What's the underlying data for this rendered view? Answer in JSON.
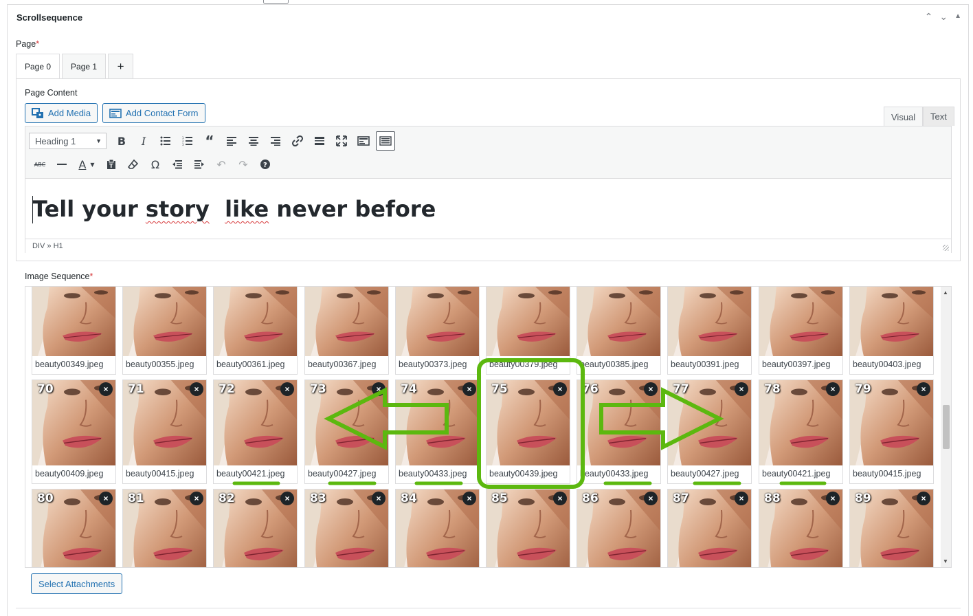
{
  "window": {
    "title": "Scrollsequence",
    "controls": [
      "chevron-up-icon",
      "chevron-down-icon",
      "triangle-up-icon"
    ]
  },
  "page_field": {
    "label": "Page",
    "required_mark": "*",
    "tabs": [
      {
        "label": "Page 0",
        "active": true
      },
      {
        "label": "Page 1",
        "active": false
      },
      {
        "label": "+",
        "active": false
      }
    ]
  },
  "page_content": {
    "label": "Page Content",
    "add_media_label": "Add Media",
    "add_contact_form_label": "Add Contact Form",
    "mode_tabs": {
      "visual": "Visual",
      "text": "Text"
    },
    "format_select_value": "Heading 1",
    "toolbar_row1": [
      "bold-icon",
      "italic-icon",
      "bullet-list-icon",
      "numbered-list-icon",
      "blockquote-icon",
      "align-left-icon",
      "align-center-icon",
      "align-right-icon",
      "link-icon",
      "read-more-icon",
      "fullscreen-icon",
      "form-icon",
      "toolbar-toggle-icon"
    ],
    "toolbar_row2": [
      "strikethrough-icon",
      "horizontal-line-icon",
      "text-color-icon",
      "paste-text-icon",
      "clear-formatting-icon",
      "special-character-icon",
      "outdent-icon",
      "indent-icon",
      "undo-icon",
      "redo-icon",
      "help-icon"
    ],
    "heading_parts": [
      "Tell your ",
      "story",
      "  ",
      "like",
      " never before"
    ],
    "path": "DIV » H1"
  },
  "image_sequence": {
    "label": "Image Sequence",
    "required_mark": "*",
    "rows": [
      {
        "numbers": [
          "",
          "",
          "",
          "",
          "",
          "",
          "",
          "",
          "",
          ""
        ],
        "files": [
          "beauty00349.jpeg",
          "beauty00355.jpeg",
          "beauty00361.jpeg",
          "beauty00367.jpeg",
          "beauty00373.jpeg",
          "beauty00379.jpeg",
          "beauty00385.jpeg",
          "beauty00391.jpeg",
          "beauty00397.jpeg",
          "beauty00403.jpeg"
        ]
      },
      {
        "numbers": [
          "70",
          "71",
          "72",
          "73",
          "74",
          "75",
          "76",
          "77",
          "78",
          "79"
        ],
        "files": [
          "beauty00409.jpeg",
          "beauty00415.jpeg",
          "beauty00421.jpeg",
          "beauty00427.jpeg",
          "beauty00433.jpeg",
          "beauty00439.jpeg",
          "beauty00433.jpeg",
          "beauty00427.jpeg",
          "beauty00421.jpeg",
          "beauty00415.jpeg"
        ]
      },
      {
        "numbers": [
          "80",
          "81",
          "82",
          "83",
          "84",
          "85",
          "86",
          "87",
          "88",
          "89"
        ],
        "files": [
          "",
          "",
          "",
          "",
          "",
          "",
          "",
          "",
          "",
          ""
        ]
      }
    ],
    "remove_glyph": "×",
    "select_attachments_label": "Select Attachments"
  },
  "colors": {
    "accent": "#2271b1",
    "annotation_green": "#5cb80f",
    "required": "#d63638"
  }
}
